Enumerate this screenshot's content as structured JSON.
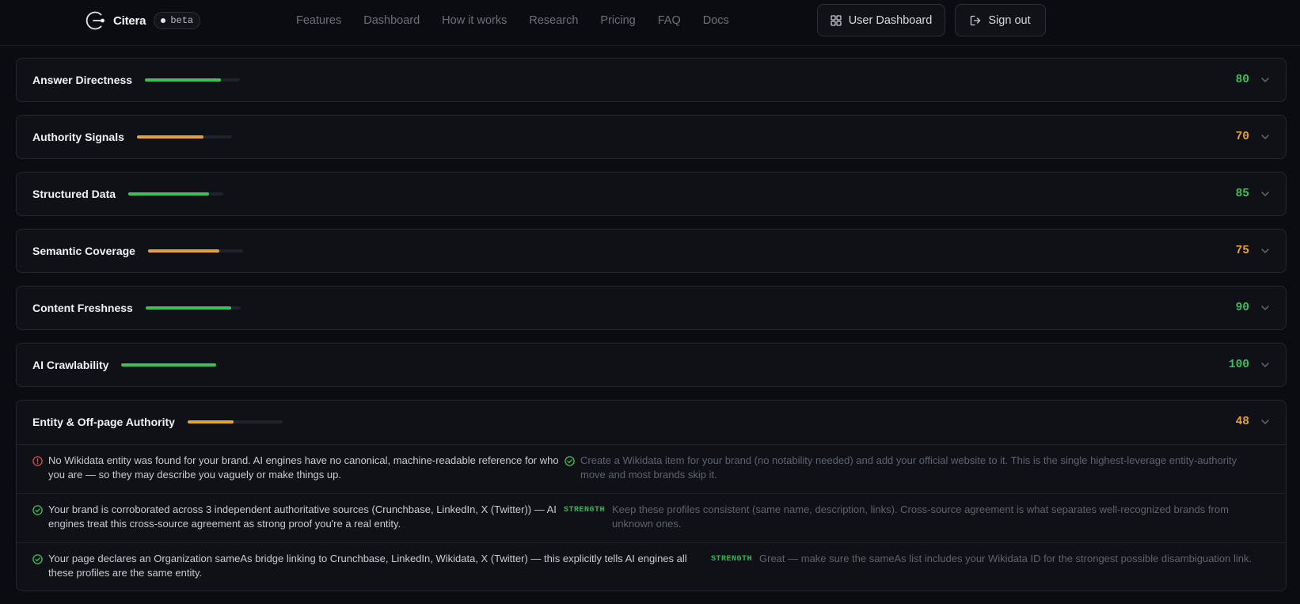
{
  "header": {
    "brand": "Citera",
    "badge": "beta",
    "nav": [
      "Features",
      "Dashboard",
      "How it works",
      "Research",
      "Pricing",
      "FAQ",
      "Docs"
    ],
    "dashboard_button": "User Dashboard",
    "signout_button": "Sign out"
  },
  "colors": {
    "green": "#3fbf5a",
    "amber": "#e3a33a",
    "error": "#e5484d"
  },
  "categories": [
    {
      "title": "Answer Directness",
      "score": "80",
      "level": 0.8,
      "tone": "green"
    },
    {
      "title": "Authority Signals",
      "score": "70",
      "level": 0.7,
      "tone": "amber"
    },
    {
      "title": "Structured Data",
      "score": "85",
      "level": 0.85,
      "tone": "green"
    },
    {
      "title": "Semantic Coverage",
      "score": "75",
      "level": 0.75,
      "tone": "amber"
    },
    {
      "title": "Content Freshness",
      "score": "90",
      "level": 0.9,
      "tone": "green"
    },
    {
      "title": "AI Crawlability",
      "score": "100",
      "level": 1.0,
      "tone": "green"
    },
    {
      "title": "Entity & Off-page Authority",
      "score": "48",
      "level": 0.48,
      "tone": "amber"
    }
  ],
  "entity_details": [
    {
      "status": "issue",
      "text": "No Wikidata entity was found for your brand. AI engines have no canonical, machine-readable reference for who you are — so they may describe you vaguely or make things up.",
      "tag": "",
      "recommendation": "Create a Wikidata item for your brand (no notability needed) and add your official website to it. This is the single highest-leverage entity-authority move and most brands skip it."
    },
    {
      "status": "ok",
      "text": "Your brand is corroborated across 3 independent authoritative sources (Crunchbase, LinkedIn, X (Twitter)) — AI engines treat this cross-source agreement as strong proof you're a real entity.",
      "tag": "STRENGTH",
      "recommendation": "Keep these profiles consistent (same name, description, links). Cross-source agreement is what separates well-recognized brands from unknown ones."
    },
    {
      "status": "ok",
      "text": "Your page declares an Organization sameAs bridge linking to Crunchbase, LinkedIn, Wikidata, X (Twitter) — this explicitly tells AI engines all these profiles are the same entity.",
      "tag": "STRENGTH",
      "recommendation": "Great — make sure the sameAs list includes your Wikidata ID for the strongest possible disambiguation link."
    }
  ]
}
